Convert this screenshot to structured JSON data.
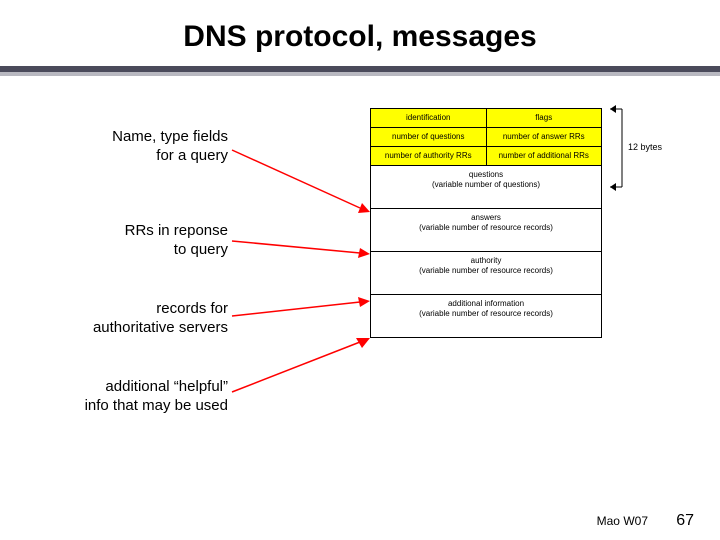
{
  "title": "DNS protocol, messages",
  "labels": {
    "l1a": "Name, type fields",
    "l1b": "for a query",
    "l2a": "RRs in reponse",
    "l2b": "to query",
    "l3a": "records for",
    "l3b": "authoritative servers",
    "l4a": "additional “helpful”",
    "l4b": "info that may be used"
  },
  "header_rows": {
    "r1c1": "identification",
    "r1c2": "flags",
    "r2c1": "number of questions",
    "r2c2": "number of answer RRs",
    "r3c1": "number of authority RRs",
    "r3c2": "number of additional RRs"
  },
  "body_rows": {
    "b1a": "questions",
    "b1b": "(variable number of questions)",
    "b2a": "answers",
    "b2b": "(variable number of resource records)",
    "b3a": "authority",
    "b3b": "(variable number of resource records)",
    "b4a": "additional information",
    "b4b": "(variable number of resource records)"
  },
  "bytes_label": "12 bytes",
  "footer": {
    "author": "Mao W07",
    "page": "67"
  }
}
